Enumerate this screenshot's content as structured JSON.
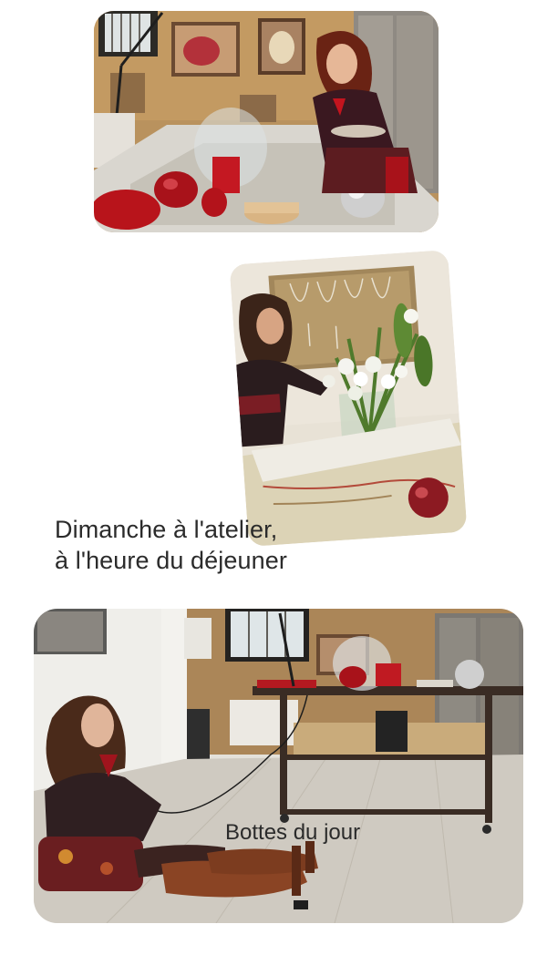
{
  "captions": {
    "first_line_1": "Dimanche à l'atelier,",
    "first_line_2": "à l'heure du déjeuner",
    "second": "Bottes du jour"
  },
  "colors": {
    "background": "#ffffff",
    "caption_text": "#2b2b2b",
    "accent_red": "#b8141b",
    "wall_ochre": "#b9925e"
  }
}
